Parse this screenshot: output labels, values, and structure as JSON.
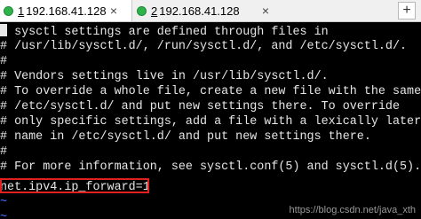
{
  "tabs": [
    {
      "number": "1",
      "host": "192.168.41.128",
      "close": "×"
    },
    {
      "number": "2",
      "host": "192.168.41.128",
      "close": "×"
    }
  ],
  "tab_add": "+",
  "terminal": {
    "lines": [
      "# sysctl settings are defined through files in",
      "# /usr/lib/sysctl.d/, /run/sysctl.d/, and /etc/sysctl.d/.",
      "#",
      "# Vendors settings live in /usr/lib/sysctl.d/.",
      "# To override a whole file, create a new file with the same in",
      "# /etc/sysctl.d/ and put new settings there. To override",
      "# only specific settings, add a file with a lexically later",
      "# name in /etc/sysctl.d/ and put new settings there.",
      "#",
      "# For more information, see sysctl.conf(5) and sysctl.d(5).",
      "",
      "net.ipv4.ip_forward=1",
      "~",
      "~"
    ]
  },
  "watermark": "https://blog.csdn.net/java_xth",
  "colors": {
    "terminal_bg": "#000000",
    "terminal_fg": "#e6e6e6",
    "highlight_border": "#e02020",
    "tilde": "#3a78ff",
    "status_dot": "#2db34a"
  }
}
